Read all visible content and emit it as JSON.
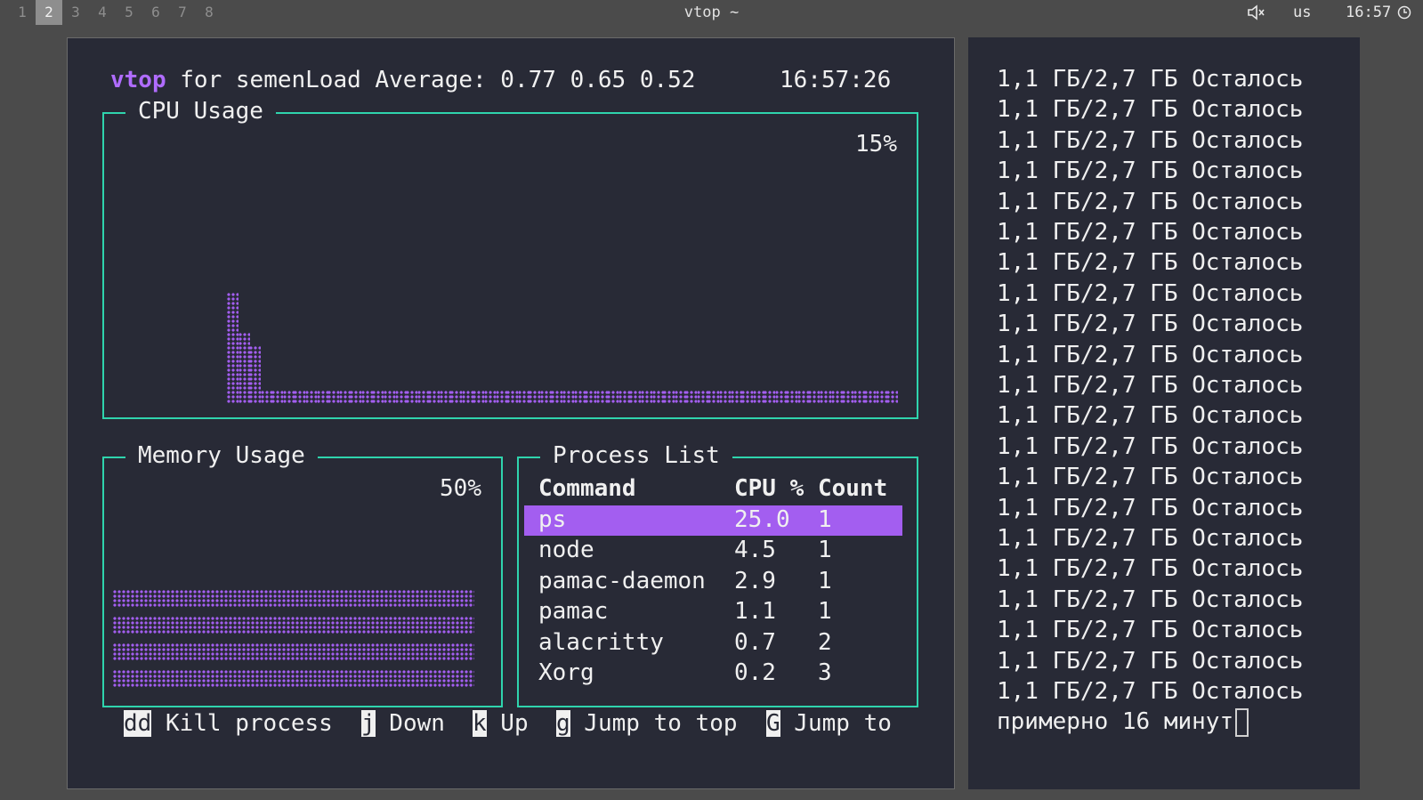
{
  "topbar": {
    "workspaces": [
      "1",
      "2",
      "3",
      "4",
      "5",
      "6",
      "7",
      "8"
    ],
    "active_workspace": "2",
    "window_title": "vtop ~",
    "volume_icon": "speaker-muted-icon",
    "volume_label": "🔇",
    "keyboard_layout": "us",
    "clock": "16:57",
    "clock_icon": "clock-icon"
  },
  "vtop": {
    "app_name": "vtop",
    "header_text": " for semenLoad Average: 0.77 0.65 0.52",
    "time": "16:57:26",
    "cpu": {
      "title": "CPU Usage",
      "percent_label": "15%",
      "history": [
        62,
        40,
        32,
        8,
        8,
        8,
        8,
        8,
        8,
        8,
        8,
        8,
        8,
        8,
        8,
        8,
        8,
        8,
        8,
        8,
        8,
        8,
        8,
        8,
        8,
        8,
        8,
        8,
        8,
        8,
        8,
        8,
        8,
        8,
        8,
        8,
        8,
        8,
        8,
        8,
        8,
        8,
        8,
        8,
        8,
        8,
        8,
        8,
        8,
        8,
        8,
        8,
        8,
        8,
        8,
        8,
        8,
        8,
        8,
        8
      ]
    },
    "memory": {
      "title": "Memory Usage",
      "percent_label": "50%",
      "percent": 50
    },
    "processes": {
      "title": "Process List",
      "headers": [
        "Command",
        "CPU %",
        "Count"
      ],
      "rows": [
        [
          "ps",
          "25.0",
          "1"
        ],
        [
          "node",
          "4.5",
          "1"
        ],
        [
          "pamac-daemon",
          "2.9",
          "1"
        ],
        [
          "pamac",
          "1.1",
          "1"
        ],
        [
          "alacritty",
          "0.7",
          "2"
        ],
        [
          "Xorg",
          "0.2",
          "3"
        ]
      ],
      "selected_index": 0
    },
    "help": [
      {
        "key": "dd",
        "label": "Kill process"
      },
      {
        "key": "j",
        "label": "Down"
      },
      {
        "key": "k",
        "label": "Up"
      },
      {
        "key": "g",
        "label": "Jump to top"
      },
      {
        "key": "G",
        "label": "Jump to"
      }
    ]
  },
  "terminal": {
    "lines": [
      "1,1 ГБ/2,7 ГБ Осталось",
      "1,1 ГБ/2,7 ГБ Осталось",
      "1,1 ГБ/2,7 ГБ Осталось",
      "1,1 ГБ/2,7 ГБ Осталось",
      "1,1 ГБ/2,7 ГБ Осталось",
      "1,1 ГБ/2,7 ГБ Осталось",
      "1,1 ГБ/2,7 ГБ Осталось",
      "1,1 ГБ/2,7 ГБ Осталось",
      "1,1 ГБ/2,7 ГБ Осталось",
      "1,1 ГБ/2,7 ГБ Осталось",
      "1,1 ГБ/2,7 ГБ Осталось",
      "1,1 ГБ/2,7 ГБ Осталось",
      "1,1 ГБ/2,7 ГБ Осталось",
      "1,1 ГБ/2,7 ГБ Осталось",
      "1,1 ГБ/2,7 ГБ Осталось",
      "1,1 ГБ/2,7 ГБ Осталось",
      "1,1 ГБ/2,7 ГБ Осталось",
      "1,1 ГБ/2,7 ГБ Осталось",
      "1,1 ГБ/2,7 ГБ Осталось",
      "1,1 ГБ/2,7 ГБ Осталось",
      "1,1 ГБ/2,7 ГБ Осталось"
    ],
    "prompt_line": "примерно 16 минут"
  },
  "colors": {
    "terminal_bg": "#282a36",
    "border": "#2fd4ad",
    "accent": "#a35ef0"
  }
}
